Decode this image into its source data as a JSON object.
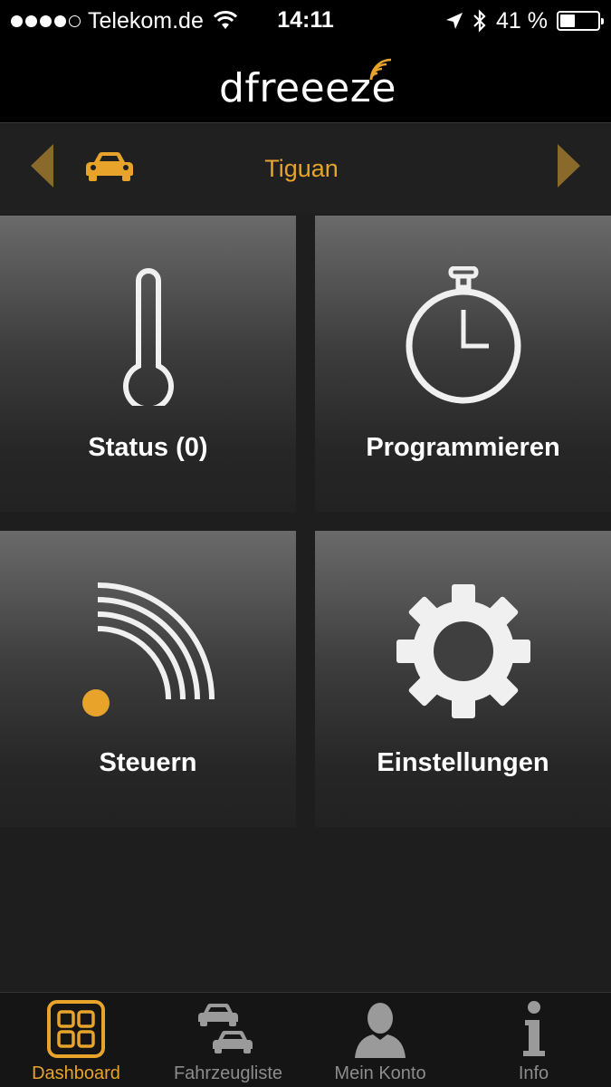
{
  "status_bar": {
    "carrier": "Telekom.de",
    "time": "14:11",
    "battery_percent": "41 %",
    "battery_level": 0.41
  },
  "header": {
    "logo_text": "dfreeeze"
  },
  "vehicle": {
    "name": "Tiguan"
  },
  "tiles": {
    "status": "Status (0)",
    "programmieren": "Programmieren",
    "steuern": "Steuern",
    "einstellungen": "Einstellungen"
  },
  "tabs": {
    "dashboard": "Dashboard",
    "fahrzeugliste": "Fahrzeugliste",
    "mein_konto": "Mein Konto",
    "info": "Info"
  },
  "colors": {
    "accent": "#e8a32a",
    "background": "#1e1e1e",
    "inactive": "#8c8c8c"
  }
}
